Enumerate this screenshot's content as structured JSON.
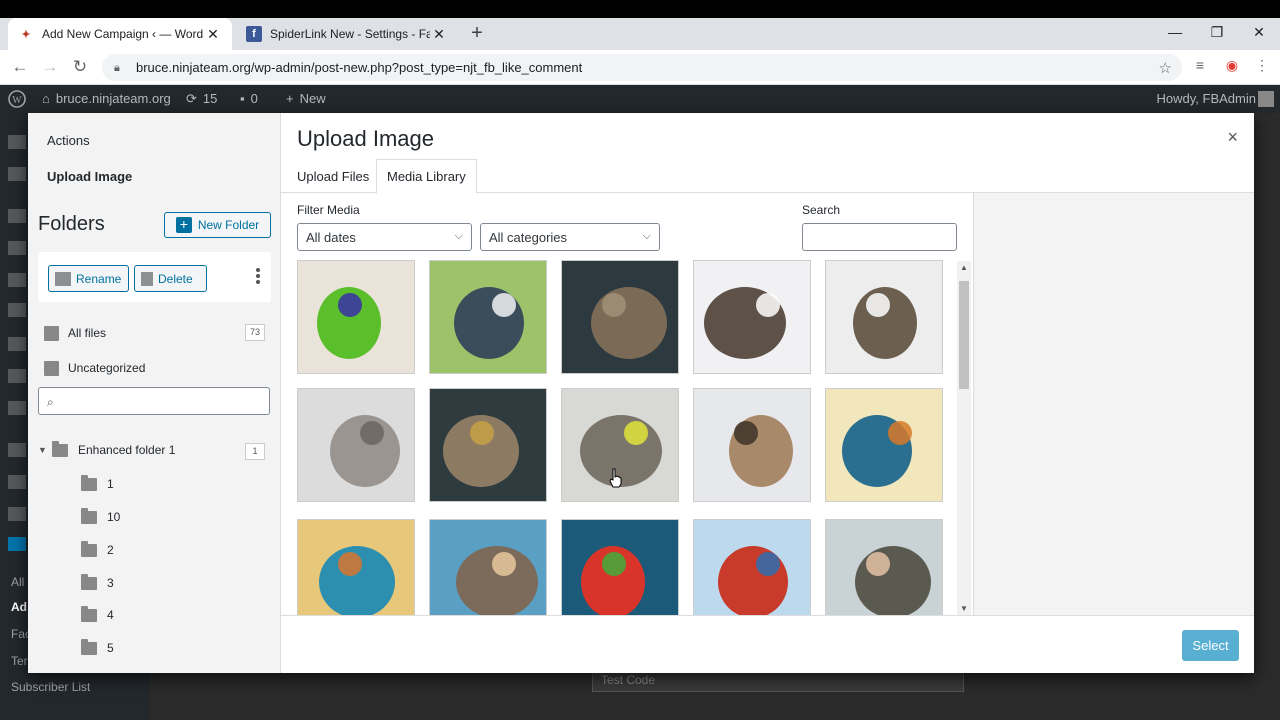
{
  "browser": {
    "tabs": [
      {
        "title": "Add New Campaign ‹ — WordPr",
        "favicon": "wordpress-favicon",
        "active": true
      },
      {
        "title": "SpiderLink New - Settings - Face",
        "favicon": "facebook-favicon",
        "active": false
      }
    ],
    "url": "bruce.ninjateam.org/wp-admin/post-new.php?post_type=njt_fb_like_comment",
    "window_controls": [
      "—",
      "❐",
      "✕"
    ]
  },
  "adminbar": {
    "site": "bruce.ninjateam.org",
    "updates": "15",
    "comments": "0",
    "new": "New",
    "howdy": "Howdy, FBAdmin"
  },
  "wp_sidebar": {
    "labels": [
      "All",
      "Ad",
      "Fac",
      "Ter",
      "Subscriber List"
    ]
  },
  "background": {
    "select_value": "Test Code"
  },
  "modal": {
    "menu": {
      "actions": "Actions",
      "upload_image": "Upload Image"
    },
    "folders": {
      "title": "Folders",
      "new_folder": "New Folder",
      "rename": "Rename",
      "delete": "Delete",
      "all_files": "All files",
      "all_files_count": "73",
      "uncategorized": "Uncategorized",
      "tree": [
        {
          "label": "Enhanced folder 1",
          "count": "1",
          "expanded": true
        },
        {
          "label": "1"
        },
        {
          "label": "10"
        },
        {
          "label": "2"
        },
        {
          "label": "3"
        },
        {
          "label": "4"
        },
        {
          "label": "5"
        }
      ]
    },
    "title": "Upload Image",
    "close": "×",
    "tabs": [
      "Upload Files",
      "Media Library"
    ],
    "active_tab": "Media Library",
    "filter_label": "Filter Media",
    "filter_dates": "All dates",
    "filter_categories": "All categories",
    "search_label": "Search",
    "search_value": "",
    "select_button": "Select",
    "images": [
      {
        "subject": "lorikeet parrot",
        "bg": "#e9e3da",
        "fg": "#5bbf2b",
        "accent": "#3a2fa8"
      },
      {
        "subject": "man with white dog",
        "bg": "#9cc36a",
        "fg": "#3b4d5a",
        "accent": "#f2f2f2"
      },
      {
        "subject": "tabby cat portrait",
        "bg": "#2c3a3f",
        "fg": "#7b6a55",
        "accent": "#a09078"
      },
      {
        "subject": "cat on shelf",
        "bg": "#f1f1f3",
        "fg": "#5d5148",
        "accent": "#ffffff"
      },
      {
        "subject": "cat on chair",
        "bg": "#ededee",
        "fg": "#6c5f50",
        "accent": "#ffffff"
      },
      {
        "subject": "grey kitten",
        "bg": "#dcdcdc",
        "fg": "#9a9590",
        "accent": "#6b6560"
      },
      {
        "subject": "cat closeup",
        "bg": "#2e3b3f",
        "fg": "#8d7a63",
        "accent": "#c6a143"
      },
      {
        "subject": "cat from above",
        "bg": "#d8d8d4",
        "fg": "#7a746a",
        "accent": "#e1e43a"
      },
      {
        "subject": "surprised cat",
        "bg": "#e6e8ec",
        "fg": "#a88a6a",
        "accent": "#3d3228"
      },
      {
        "subject": "kingfisher",
        "bg": "#f2e6bc",
        "fg": "#2a6f8f",
        "accent": "#d77a2a"
      },
      {
        "subject": "kingfisher on branch",
        "bg": "#e7c77a",
        "fg": "#2d8fb0",
        "accent": "#d8742e"
      },
      {
        "subject": "seagulls in sky",
        "bg": "#5aa0c4",
        "fg": "#7c6a5b",
        "accent": "#e8c79c"
      },
      {
        "subject": "macaw parrot",
        "bg": "#1c5a7a",
        "fg": "#d8342a",
        "accent": "#3fae3a"
      },
      {
        "subject": "flying macaw",
        "bg": "#bcd9ee",
        "fg": "#c83a2a",
        "accent": "#2d6fb0"
      },
      {
        "subject": "bird on hand",
        "bg": "#c9d3d6",
        "fg": "#5b5a50",
        "accent": "#e4c2a4"
      }
    ]
  },
  "colors": {
    "wp_dark": "#23282d",
    "wp_blue": "#0071a1",
    "primary_button": "#0085ba"
  }
}
